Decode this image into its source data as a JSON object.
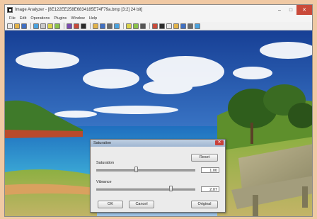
{
  "window": {
    "title": "Image Analyzer - [8E122EE258E6834185E74F79a.bmp [3:2] 24 bit]",
    "controls": {
      "minimize": "–",
      "maximize": "□",
      "close": "✕"
    }
  },
  "menu": [
    "File",
    "Edit",
    "Operations",
    "Plugins",
    "Window",
    "Help"
  ],
  "toolbar_icons": [
    "new-icon",
    "open-icon",
    "save-icon",
    "sep",
    "print-icon",
    "copy-icon",
    "paste-icon",
    "crop-icon",
    "sep",
    "undo-icon",
    "redo-icon",
    "rotate-icon",
    "sep",
    "histogram-icon",
    "curves-icon",
    "levels-icon",
    "select-icon",
    "sep",
    "zoom-icon",
    "fit-icon",
    "line-icon",
    "sep",
    "palette-icon",
    "grid-icon",
    "filter-icon",
    "color-icon",
    "mask-icon",
    "channel-icon",
    "frame-icon"
  ],
  "dialog": {
    "title": "Saturation",
    "reset_label": "Reset",
    "saturation_label": "Saturation",
    "saturation_value": "1.00",
    "saturation_level": 0.4,
    "vibrance_label": "Vibrance",
    "vibrance_value": "2.07",
    "vibrance_level": 0.75,
    "ok_label": "OK",
    "cancel_label": "Cancel",
    "original_label": "Original",
    "close_glyph": "✕"
  },
  "colors": {
    "sky_top": "#1d4fa8",
    "sea": "#1f8fcf",
    "grass": "#7aa03a",
    "close_red": "#c94a3a"
  }
}
